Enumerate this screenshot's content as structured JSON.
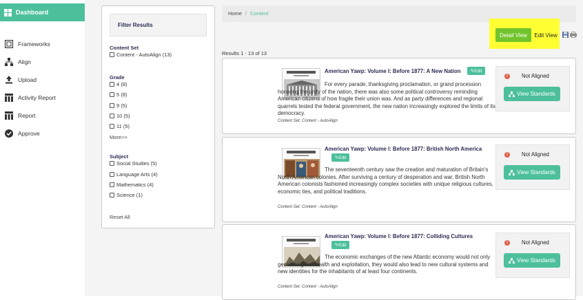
{
  "sidebar": {
    "dashboard": "Dashboard",
    "items": [
      {
        "label": "Frameworks",
        "icon": "frameworks-icon"
      },
      {
        "label": "Align",
        "icon": "align-icon"
      },
      {
        "label": "Upload",
        "icon": "upload-icon"
      },
      {
        "label": "Activity Report",
        "icon": "activity-report-icon"
      },
      {
        "label": "Report",
        "icon": "report-icon"
      },
      {
        "label": "Approve",
        "icon": "approve-icon"
      }
    ]
  },
  "filter": {
    "title": "Filter Results",
    "content_set": {
      "title": "Content Set",
      "options": [
        "Content - AutoAlign (13)"
      ]
    },
    "grade": {
      "title": "Grade",
      "options": [
        "4 (8)",
        "5 (8)",
        "9 (5)",
        "10 (5)",
        "11 (5)"
      ],
      "more": "More>>"
    },
    "subject": {
      "title": "Subject",
      "options": [
        "Social Studies (5)",
        "Language Arts (4)",
        "Mathematics (4)",
        "Science (1)"
      ]
    },
    "reset": "Reset All"
  },
  "breadcrumb": {
    "home": "Home",
    "separator": "/",
    "current": "Content"
  },
  "views": {
    "detail": "Detail View",
    "edit": "Edit View"
  },
  "results_text": "Results 1 - 13 of 13",
  "edit_label": "Edit",
  "status_label": "Not Aligned",
  "view_standards_label": "View Standards",
  "thumb_heading": "THE AMERICAN YAWP",
  "cards": [
    {
      "title": "American Yawp: Volume I: Before 1877: A New Nation",
      "description": "For every parade, thanksgiving proclamation, or grand procession honoring the unity of the nation, there was also some political controversy reminding American citizens of how fragile their union was. And as party differences and regional quarrels tested the federal government, the new nation increasingly explored the limits of its democracy.",
      "content_set": "Content Set: Content - AutoAlign"
    },
    {
      "title": "American Yawp: Volume I: Before 1877: British North America",
      "description": "The seventeenth century saw the creation and maturation of Britain's North American colonies. After surviving a century of desperation and war, British North American colonists fashioned increasingly complex societies with unique religious cultures, economic ties, and political traditions.",
      "content_set": "Content Set: Content - AutoAlign"
    },
    {
      "title": "American Yawp: Volume I: Before 1877: Colliding Cultures",
      "description": "The economic exchanges of the new Atlantic economy would not only generate great wealth and exploitation, they would also lead to new cultural systems and new identities for the inhabitants of at least four continents.",
      "content_set": "Content Set: Content - AutoAlign"
    }
  ],
  "colors": {
    "accent": "#4dbf9d",
    "highlight": "#ffff33",
    "detail_active": "#72c42c",
    "warning": "#e0614a"
  }
}
